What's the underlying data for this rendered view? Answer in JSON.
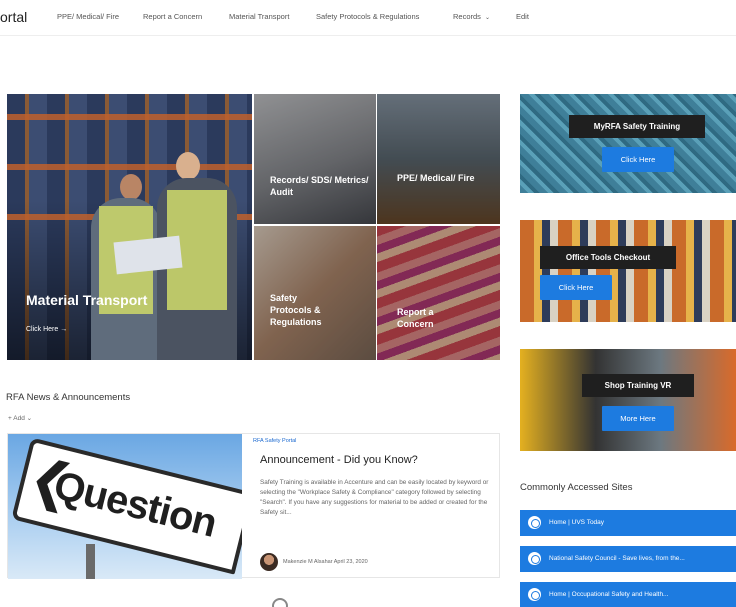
{
  "nav": {
    "brand": "ortal",
    "items": [
      {
        "label": "PPE/ Medical/ Fire"
      },
      {
        "label": "Report a Concern"
      },
      {
        "label": "Material Transport"
      },
      {
        "label": "Safety Protocols & Regulations"
      },
      {
        "label": "Records",
        "caret": "⌄"
      },
      {
        "label": "Edit"
      }
    ]
  },
  "hero": {
    "title": "Material Transport",
    "link": "Click Here  →"
  },
  "tiles": {
    "records": "Records/ SDS/ Metrics/ Audit",
    "ppe": "PPE/ Medical/ Fire",
    "safety": "Safety Protocols & Regulations",
    "report": "Report a Concern"
  },
  "promos": [
    {
      "title": "MyRFA Safety Training",
      "button": "Click Here"
    },
    {
      "title": "Office Tools Checkout",
      "button": "Click Here"
    },
    {
      "title": "Shop Training VR",
      "button": "More Here"
    }
  ],
  "news": {
    "section_title": "RFA News & Announcements",
    "add_label": "+ Add ⌄",
    "category": "RFA Safety Portal",
    "headline": "Announcement - Did you Know?",
    "body": "Safety Training is available in Accenture and can be easily located by keyword or selecting the \"Workplace Safety & Compliance\" category followed by selecting \"Search\". If you have any suggestions for material to be added or created for the Safety sit...",
    "author": "Makenzie M Alsahar  April 23, 2020",
    "image_text": "Question"
  },
  "commonly_accessed": {
    "title": "Commonly Accessed Sites",
    "links": [
      "Home | UVS Today",
      "National Safety Council - Save lives, from the...",
      "Home | Occupational Safety and Health..."
    ]
  }
}
